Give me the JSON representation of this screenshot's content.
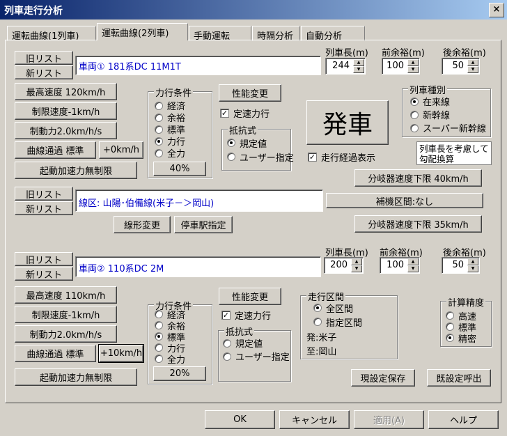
{
  "window": {
    "title": "列車走行分析",
    "close_glyph": "×"
  },
  "tabs": [
    {
      "label": "運転曲線(1列車)"
    },
    {
      "label": "運転曲線(2列車)"
    },
    {
      "label": "手動運転"
    },
    {
      "label": "時隔分析"
    },
    {
      "label": "自動分析"
    }
  ],
  "train1": {
    "old_list": "旧リスト",
    "new_list": "新リスト",
    "vehicle": "車両① 181系DC 11M1T",
    "len_label": "列車長(m)",
    "front_label": "前余裕(m)",
    "rear_label": "後余裕(m)",
    "len": "244",
    "front": "100",
    "rear": "50",
    "max_speed": "最高速度 120km/h",
    "limit_speed": "制限速度-1km/h",
    "brake": "制動力2.0km/h/s",
    "curve": "曲線通過 標準",
    "plus": "+0km/h",
    "accel": "起動加速力無制限",
    "power_title": "力行条件",
    "power_options": [
      "経済",
      "余裕",
      "標準",
      "力行",
      "全力"
    ],
    "power_selected": 3,
    "power_pct": "40%",
    "perf_change": "性能変更",
    "const_speed": "定速力行",
    "resist_title": "抵抗式",
    "resist_options": [
      "規定値",
      "ユーザー指定"
    ],
    "resist_selected": 0,
    "start": "発車",
    "show_route": "走行経過表示",
    "type_title": "列車種別",
    "type_options": [
      "在来線",
      "新幹線",
      "スーパー新幹線"
    ],
    "type_selected": 0,
    "note": "列車長を考慮して勾配換算",
    "switch_low": "分岐器速度下限 40km/h"
  },
  "line": {
    "old_list": "旧リスト",
    "new_list": "新リスト",
    "name": "線区: 山陽･伯備線(米子－＞岡山)",
    "shape_change": "線形変更",
    "stop_station": "停車駅指定",
    "aux_section": "補機区間:なし",
    "switch_low": "分岐器速度下限 35km/h"
  },
  "train2": {
    "old_list": "旧リスト",
    "new_list": "新リスト",
    "vehicle": "車両② 110系DC 2M",
    "len_label": "列車長(m)",
    "front_label": "前余裕(m)",
    "rear_label": "後余裕(m)",
    "len": "200",
    "front": "100",
    "rear": "50",
    "max_speed": "最高速度 110km/h",
    "limit_speed": "制限速度-1km/h",
    "brake": "制動力2.0km/h/s",
    "curve": "曲線通過 標準",
    "plus": "+10km/h",
    "accel": "起動加速力無制限",
    "power_title": "力行条件",
    "power_options": [
      "経済",
      "余裕",
      "標準",
      "力行",
      "全力"
    ],
    "power_selected": 2,
    "power_pct": "20%",
    "perf_change": "性能変更",
    "const_speed": "定速力行",
    "resist_title": "抵抗式",
    "resist_options": [
      "規定値",
      "ユーザー指定"
    ],
    "resist_selected": -1
  },
  "section": {
    "title": "走行区間",
    "options": [
      "全区間",
      "指定区間"
    ],
    "selected": 0,
    "from": "発:米子",
    "to": "至:岡山"
  },
  "precision": {
    "title": "計算精度",
    "options": [
      "高速",
      "標準",
      "精密"
    ],
    "selected": 2
  },
  "save_settings": "現設定保存",
  "load_settings": "既設定呼出",
  "footer": {
    "ok": "OK",
    "cancel": "キャンセル",
    "apply": "適用(A)",
    "help": "ヘルプ"
  }
}
